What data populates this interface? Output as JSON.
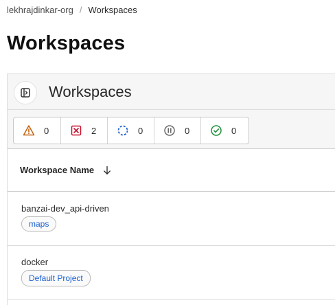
{
  "breadcrumb": {
    "org": "lekhrajdinkar-org",
    "separator": "/",
    "current": "Workspaces"
  },
  "page": {
    "title": "Workspaces"
  },
  "panel": {
    "title": "Workspaces",
    "toggle_icon": "sidebar-toggle-icon"
  },
  "status_counts": [
    {
      "status": "warning",
      "icon": "warning-triangle-icon",
      "color": "#c4620c",
      "count": "0"
    },
    {
      "status": "errored",
      "icon": "error-x-icon",
      "color": "#c8102e",
      "count": "2"
    },
    {
      "status": "running",
      "icon": "spinner-icon",
      "color": "#1f62d0",
      "count": "0"
    },
    {
      "status": "paused",
      "icon": "pause-icon",
      "color": "#6a6a6a",
      "count": "0"
    },
    {
      "status": "applied",
      "icon": "check-circle-icon",
      "color": "#1f8f3a",
      "count": "0"
    }
  ],
  "table": {
    "column_header": "Workspace Name",
    "sort_icon": "arrow-down-icon",
    "rows": [
      {
        "name": "banzai-dev_api-driven",
        "tag": "maps"
      },
      {
        "name": "docker",
        "tag": "Default Project"
      }
    ]
  },
  "colors": {
    "link_blue": "#1a5fd0",
    "header_bg": "#f6f6f6"
  }
}
